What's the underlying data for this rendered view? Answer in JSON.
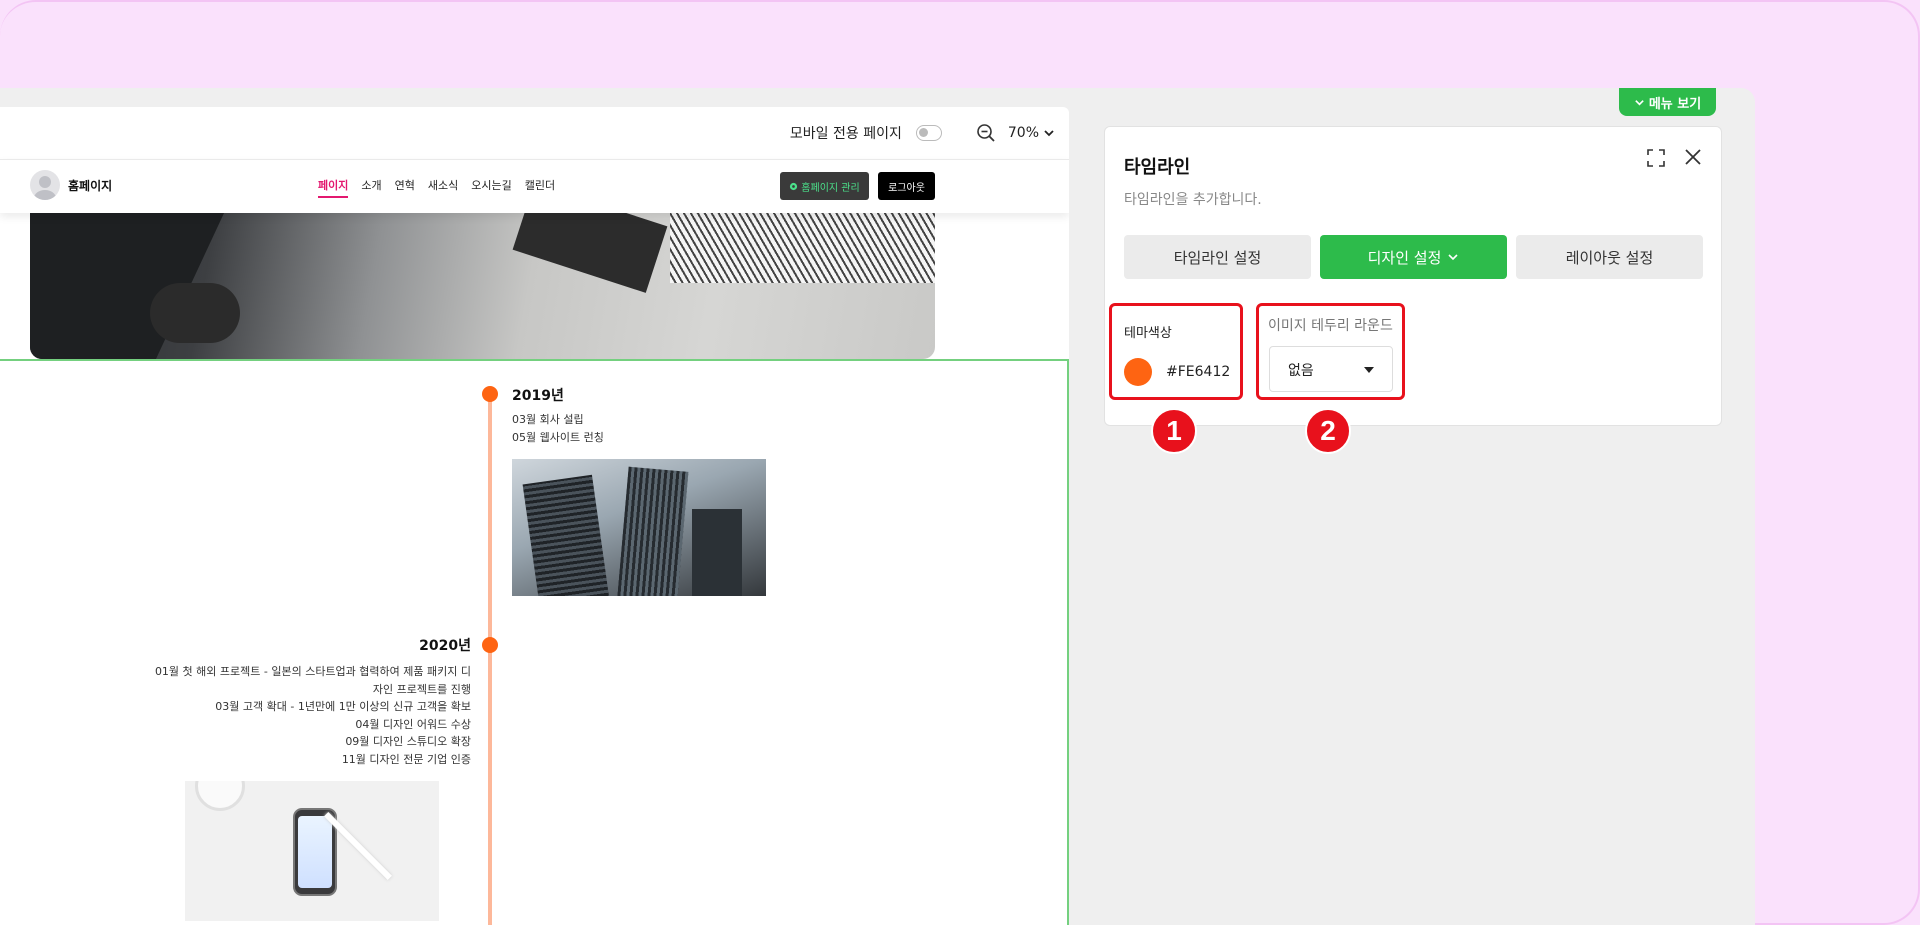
{
  "preview": {
    "toolbar": {
      "mobile_label": "모바일 전용 페이지",
      "zoom": "70%"
    },
    "site": {
      "title": "홈페이지",
      "nav": [
        "페이지",
        "소개",
        "연혁",
        "새소식",
        "오시는길",
        "캘린더"
      ],
      "manage_button": "홈페이지 관리",
      "logout_button": "로그아웃"
    },
    "timeline": [
      {
        "year": "2019년",
        "events": [
          "03월 회사 설립",
          "05월 웹사이트 런칭"
        ]
      },
      {
        "year": "2020년",
        "events": [
          "01월 첫 해외 프로젝트 - 일본의 스타트업과 협력하여 제품 패키지 디자인 프로젝트를 진행",
          "03월 고객 확대 - 1년만에 1만 이상의 신규 고객을 확보",
          "04월 디자인 어워드 수상",
          "09월 디자인 스튜디오 확장",
          "11월 디자인 전문 기업 인증"
        ]
      }
    ],
    "accent_color": "#FE6412"
  },
  "panel": {
    "menu_button": "메뉴 보기",
    "title": "타임라인",
    "subtitle": "타임라인을 추가합니다.",
    "tabs": [
      "타임라인 설정",
      "디자인 설정",
      "레이아웃 설정"
    ],
    "active_tab": "디자인 설정",
    "theme_label": "테마색상",
    "theme_value": "#FE6412",
    "round_label": "이미지 테두리 라운드",
    "round_value": "없음"
  },
  "badges": [
    "1",
    "2"
  ],
  "colors": {
    "green": "#2DBB4B",
    "highlight": "#E8111C",
    "background": "#FAE1FC"
  }
}
